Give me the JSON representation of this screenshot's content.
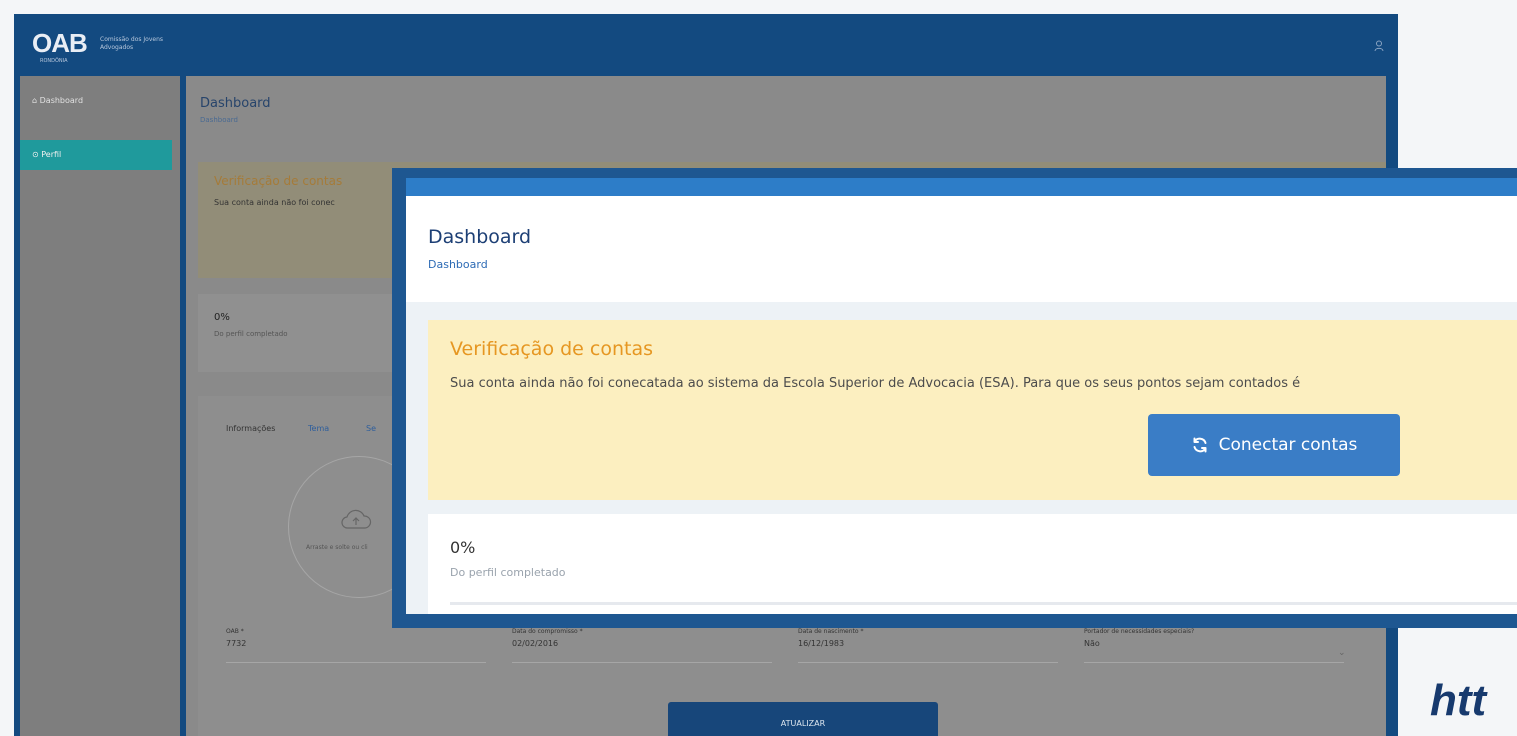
{
  "background": {
    "logo": {
      "text": "OAB",
      "subtitle": "Comissão dos Jovens Advogados",
      "tag": "RONDÔNIA"
    },
    "sidebar": {
      "items": [
        {
          "label": "Dashboard"
        },
        {
          "label": "Perfil"
        }
      ]
    },
    "page": {
      "title": "Dashboard",
      "breadcrumb": "Dashboard"
    },
    "alert": {
      "title": "Verificação de contas",
      "text": "Sua conta ainda não foi conec"
    },
    "progress": {
      "percent_label": "0%",
      "caption": "Do perfil completado"
    },
    "tabs": [
      "Informações",
      "Tema",
      "Se"
    ],
    "photo_upload_text": "Arraste e solte ou cli",
    "fields": [
      {
        "label": "OAB *",
        "value": "7732"
      },
      {
        "label": "Data do compromisso *",
        "value": "02/02/2016"
      },
      {
        "label": "Data de nascimento *",
        "value": "16/12/1983"
      },
      {
        "label": "Portador de necessidades especiais?",
        "value": "Não"
      }
    ],
    "update_button": "ATUALIZAR"
  },
  "foreground": {
    "page": {
      "title": "Dashboard",
      "breadcrumb": "Dashboard"
    },
    "alert": {
      "title": "Verificação de contas",
      "text": "Sua conta ainda não foi conecatada ao sistema da Escola Superior de Advocacia (ESA). Para que os seus pontos sejam contados é",
      "button": "Conectar contas"
    },
    "progress": {
      "percent_label": "0%",
      "caption": "Do perfil completado",
      "value": 0
    }
  },
  "url_fragment": "htt",
  "colors": {
    "brand": "#134a80",
    "accent": "#2d7dc8",
    "teal": "#1f9a9c",
    "alert_bg": "#fcefc0",
    "alert_title": "#e69722"
  }
}
